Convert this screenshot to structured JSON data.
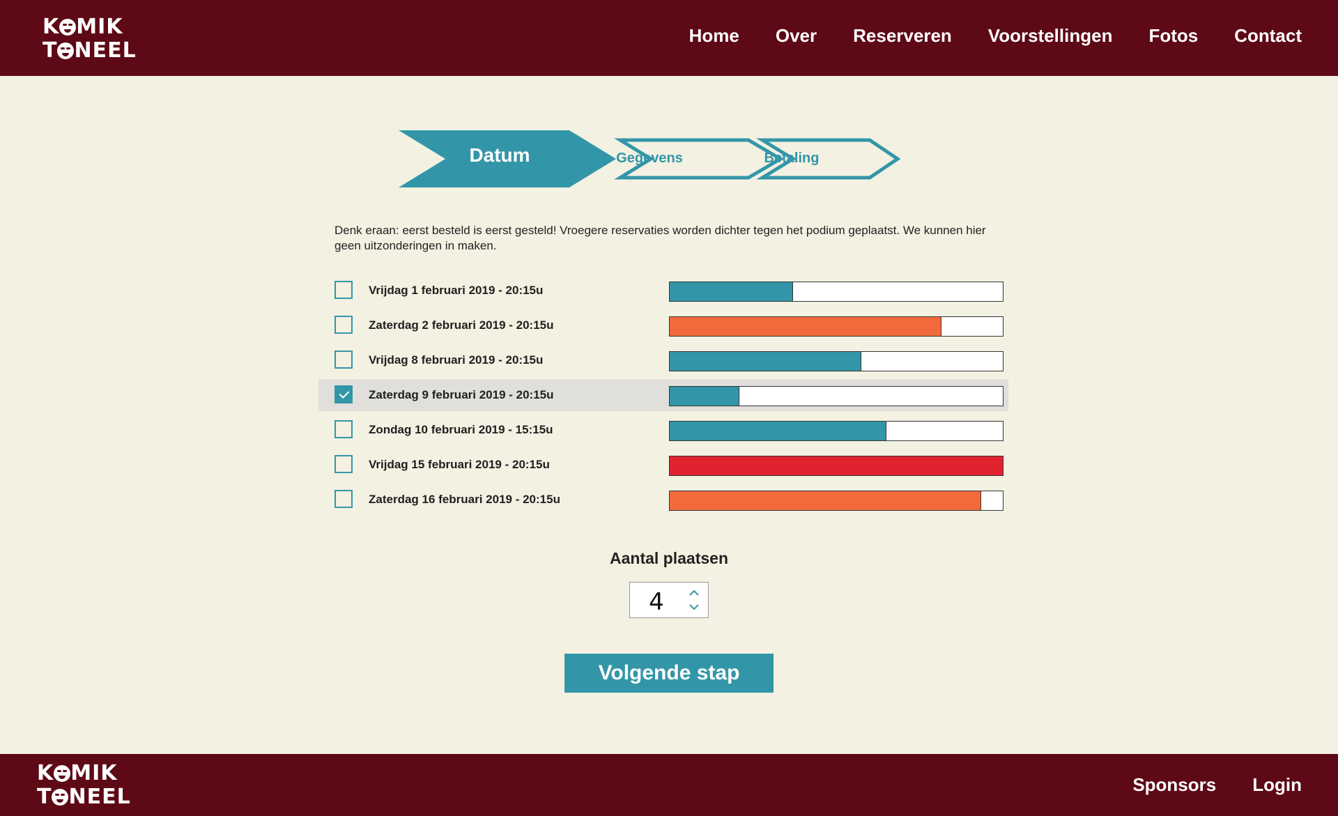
{
  "brand": {
    "line1_a": "K",
    "line1_b": "MIK",
    "line2_a": "T",
    "line2_b": "NEEL"
  },
  "nav": {
    "items": [
      "Home",
      "Over",
      "Reserveren",
      "Voorstellingen",
      "Fotos",
      "Contact"
    ]
  },
  "steps": [
    {
      "label": "Datum",
      "active": true
    },
    {
      "label": "Gegevens",
      "active": false
    },
    {
      "label": "Betaling",
      "active": false
    }
  ],
  "intro": "Denk eraan: eerst besteld is eerst gesteld! Vroegere reservaties worden dichter tegen het podium geplaatst. We kunnen hier geen uitzonderingen in maken.",
  "dates": [
    {
      "label": "Vrijdag 1 februari 2019 - 20:15u",
      "checked": false,
      "occupancy": 0.37,
      "color": "#3396a8"
    },
    {
      "label": "Zaterdag 2 februari 2019 - 20:15u",
      "checked": false,
      "occupancy": 0.815,
      "color": "#f26a3b"
    },
    {
      "label": "Vrijdag 8 februari 2019 - 20:15u",
      "checked": false,
      "occupancy": 0.575,
      "color": "#3396a8"
    },
    {
      "label": "Zaterdag 9 februari 2019 - 20:15u",
      "checked": true,
      "occupancy": 0.21,
      "color": "#3396a8"
    },
    {
      "label": "Zondag 10 februari 2019 - 15:15u",
      "checked": false,
      "occupancy": 0.65,
      "color": "#3396a8"
    },
    {
      "label": "Vrijdag 15 februari 2019 - 20:15u",
      "checked": false,
      "occupancy": 1.0,
      "color": "#e0232e"
    },
    {
      "label": "Zaterdag 16 februari 2019 - 20:15u",
      "checked": false,
      "occupancy": 0.935,
      "color": "#f26a3b"
    }
  ],
  "quantity": {
    "label": "Aantal plaatsen",
    "value": "4"
  },
  "next_button": "Volgende stap",
  "footer": {
    "items": [
      "Sponsors",
      "Login"
    ]
  },
  "colors": {
    "brand_dark": "#5e0916",
    "accent": "#3396a8",
    "background": "#f3f1e2"
  }
}
